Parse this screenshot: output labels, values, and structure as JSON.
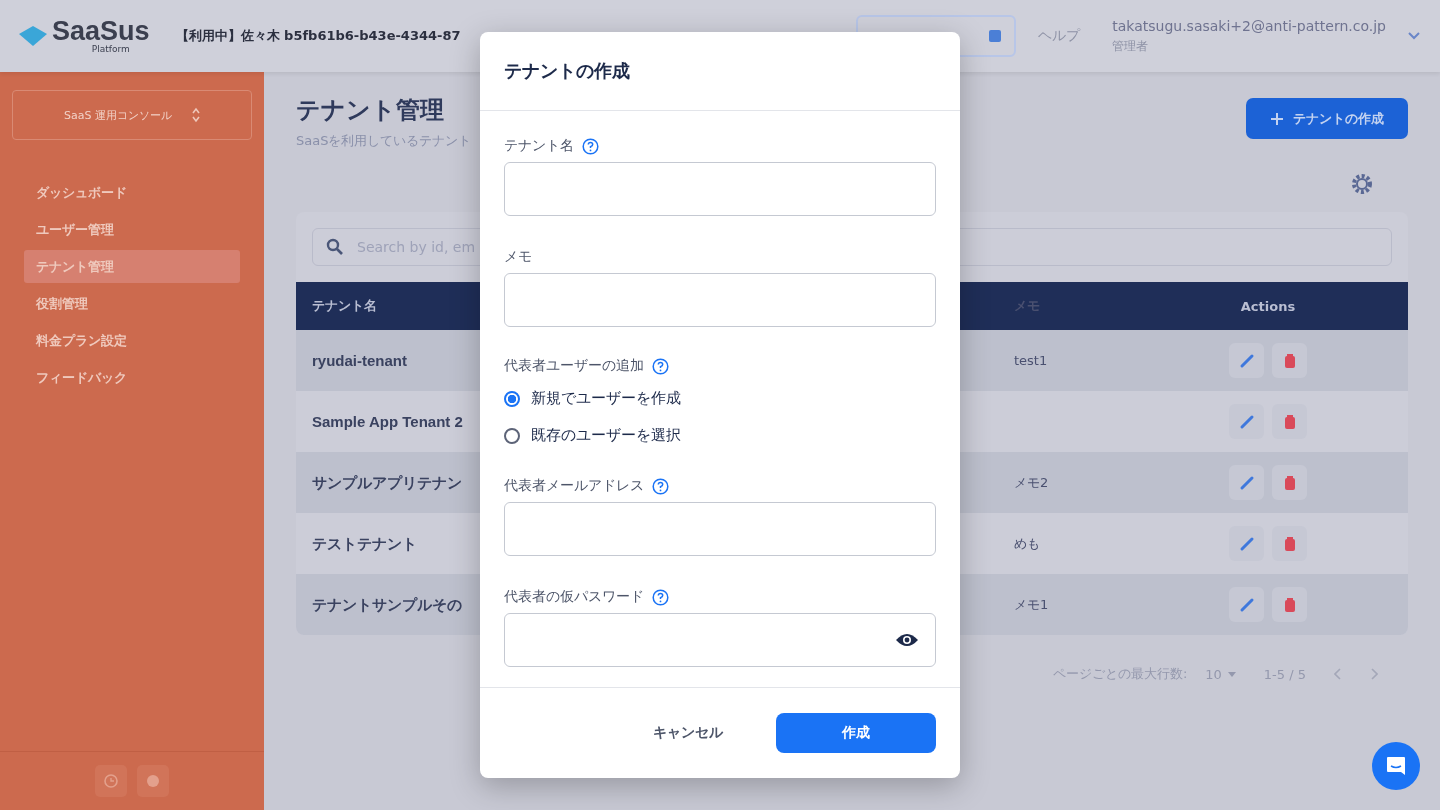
{
  "header": {
    "logo": "SaaSus",
    "logo_sub": "Platform",
    "env_label": "【利用中】佐々木 b5fb61b6-b43e-4344-87",
    "help": "ヘルプ",
    "email": "takatsugu.sasaki+2@anti-pattern.co.jp",
    "role": "管理者"
  },
  "sidebar": {
    "console_selector": "SaaS 運用コンソール",
    "items": [
      {
        "label": "ダッシュボード",
        "selected": false
      },
      {
        "label": "ユーザー管理",
        "selected": false
      },
      {
        "label": "テナント管理",
        "selected": true
      },
      {
        "label": "役割管理",
        "selected": false
      },
      {
        "label": "料金プラン設定",
        "selected": false
      },
      {
        "label": "フィードバック",
        "selected": false
      }
    ]
  },
  "page": {
    "title": "テナント管理",
    "subtitle": "SaaSを利用しているテナント",
    "create_button": "テナントの作成",
    "search": {
      "placeholder": "Search by id, em"
    },
    "table": {
      "columns": [
        "テナント名",
        "メモ",
        "Actions"
      ],
      "rows": [
        {
          "name": "ryudai-tenant",
          "memo": "test1"
        },
        {
          "name": "Sample App Tenant 2",
          "memo": ""
        },
        {
          "name": "サンプルアプリテナン",
          "memo": "メモ2"
        },
        {
          "name": "テストテナント",
          "memo": "めも"
        },
        {
          "name": "テナントサンプルその",
          "memo": "メモ1"
        }
      ]
    },
    "pagination": {
      "rows_label": "ページごとの最大行数:",
      "rows_value": "10",
      "range": "1-5 / 5"
    }
  },
  "dialog": {
    "title": "テナントの作成",
    "fields": [
      {
        "kind": "text",
        "label": "テナント名",
        "help": true
      },
      {
        "kind": "text",
        "label": "メモ",
        "help": false
      },
      {
        "kind": "radio",
        "label": "代表者ユーザーの追加",
        "help": true,
        "options": [
          {
            "label": "新規でユーザーを作成",
            "selected": true
          },
          {
            "label": "既存のユーザーを選択",
            "selected": false
          }
        ]
      },
      {
        "kind": "text",
        "label": "代表者メールアドレス",
        "help": true
      },
      {
        "kind": "password",
        "label": "代表者の仮パスワード",
        "help": true
      }
    ],
    "cancel": "キャンセル",
    "submit": "作成"
  }
}
